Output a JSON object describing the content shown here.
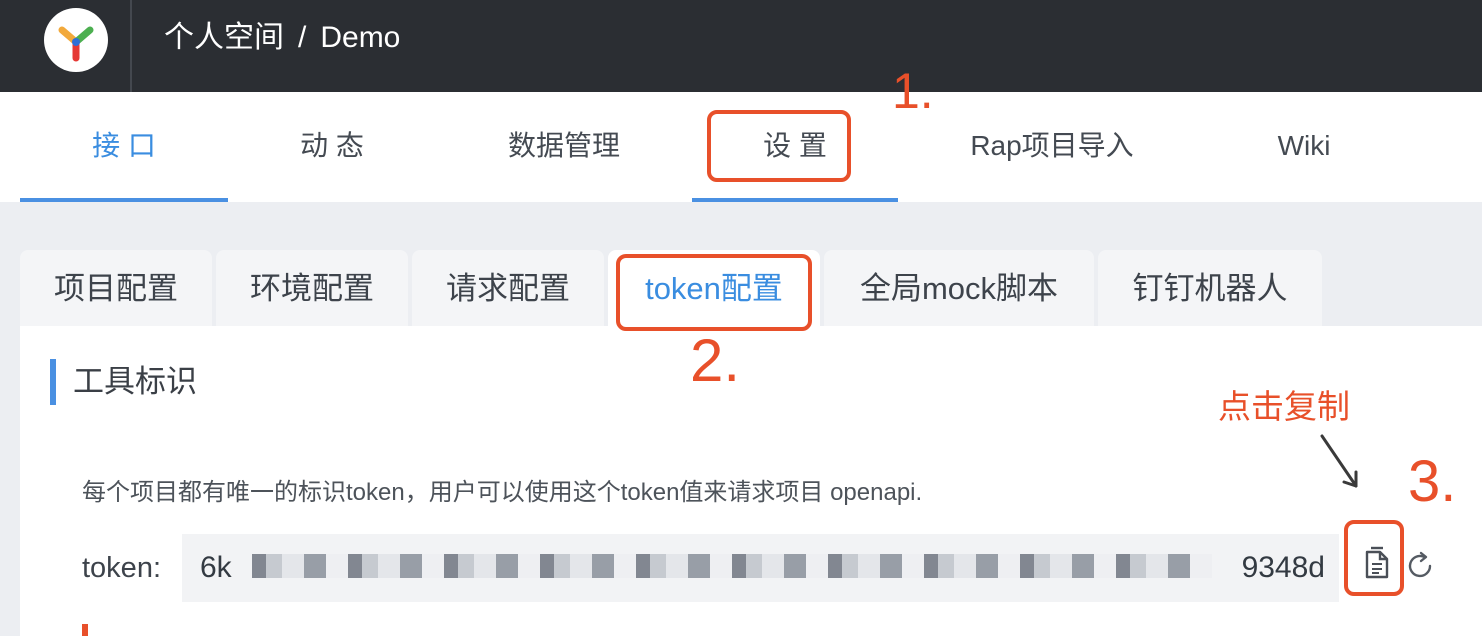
{
  "header": {
    "logo": "logo-y",
    "breadcrumb": [
      "个人空间",
      "Demo"
    ],
    "breadcrumb_separator": "/"
  },
  "main_tabs": [
    {
      "label": "接 口",
      "active": true
    },
    {
      "label": "动 态",
      "active": false
    },
    {
      "label": "数据管理",
      "active": false
    },
    {
      "label": "设 置",
      "active": false
    },
    {
      "label": "Rap项目导入",
      "active": false
    },
    {
      "label": "Wiki",
      "active": false
    }
  ],
  "sub_tabs": [
    {
      "label": "项目配置",
      "active": false
    },
    {
      "label": "环境配置",
      "active": false
    },
    {
      "label": "请求配置",
      "active": false
    },
    {
      "label": "token配置",
      "active": true
    },
    {
      "label": "全局mock脚本",
      "active": false
    },
    {
      "label": "钉钉机器人",
      "active": false
    }
  ],
  "panel": {
    "section_title": "工具标识",
    "description": "每个项目都有唯一的标识token，用户可以使用这个token值来请求项目 openapi.",
    "token_label": "token:",
    "token_visible_start": "6k",
    "token_visible_end": "9348d",
    "copy_icon": "copy-document-icon",
    "refresh_icon": "refresh-icon"
  },
  "annotations": {
    "step1": "1.",
    "step2": "2.",
    "step3": "3.",
    "copy_hint": "点击复制",
    "color": "#e8502a"
  },
  "colors": {
    "topbar": "#2b2e33",
    "accent": "#4a90e2",
    "active_text": "#3a8de0"
  }
}
